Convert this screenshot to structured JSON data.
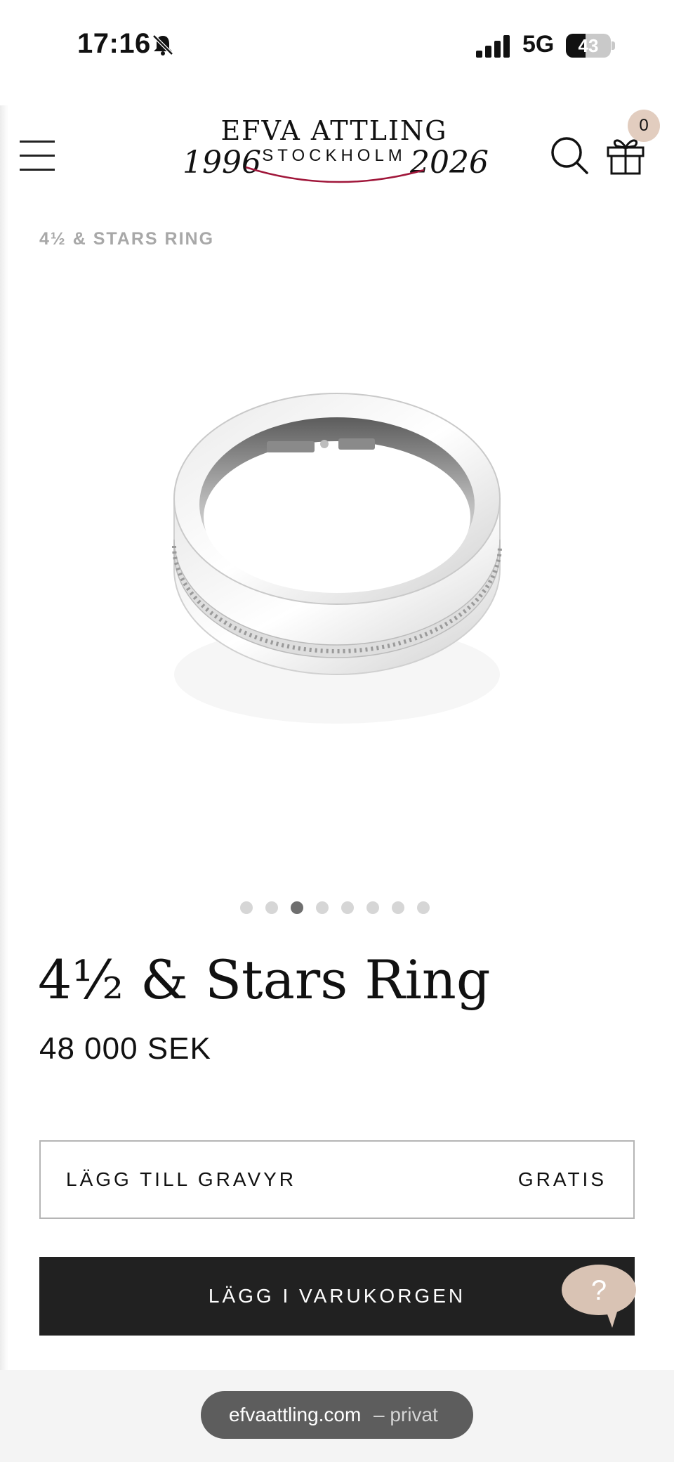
{
  "status_bar": {
    "time": "17:16",
    "network": "5G",
    "battery": "43",
    "battery_level": 0.43
  },
  "header": {
    "logo": {
      "brand": "EFVA ATTLING",
      "city": "STOCKHOLM",
      "year_left": "1996",
      "year_right": "2026",
      "accent_color": "#a0163a"
    },
    "menu_icon": "hamburger-menu-icon",
    "search_icon": "search-icon",
    "cart_icon": "gift-icon",
    "cart_count": "0",
    "badge_color": "#e2cdbf"
  },
  "breadcrumb": "4½ & STARS RING",
  "gallery": {
    "image_count": 8,
    "active_index": 2
  },
  "product": {
    "title": "4½ & Stars Ring",
    "price": "48 000 SEK"
  },
  "engraving": {
    "label": "LÄGG TILL GRAVYR",
    "value": "GRATIS"
  },
  "add_to_cart": {
    "label": "LÄGG I VARUKORGEN",
    "color": "#212121"
  },
  "help": {
    "label": "?",
    "color": "#d9c3b4"
  },
  "browser": {
    "url": "efvaattling.com",
    "mode": "– privat"
  }
}
